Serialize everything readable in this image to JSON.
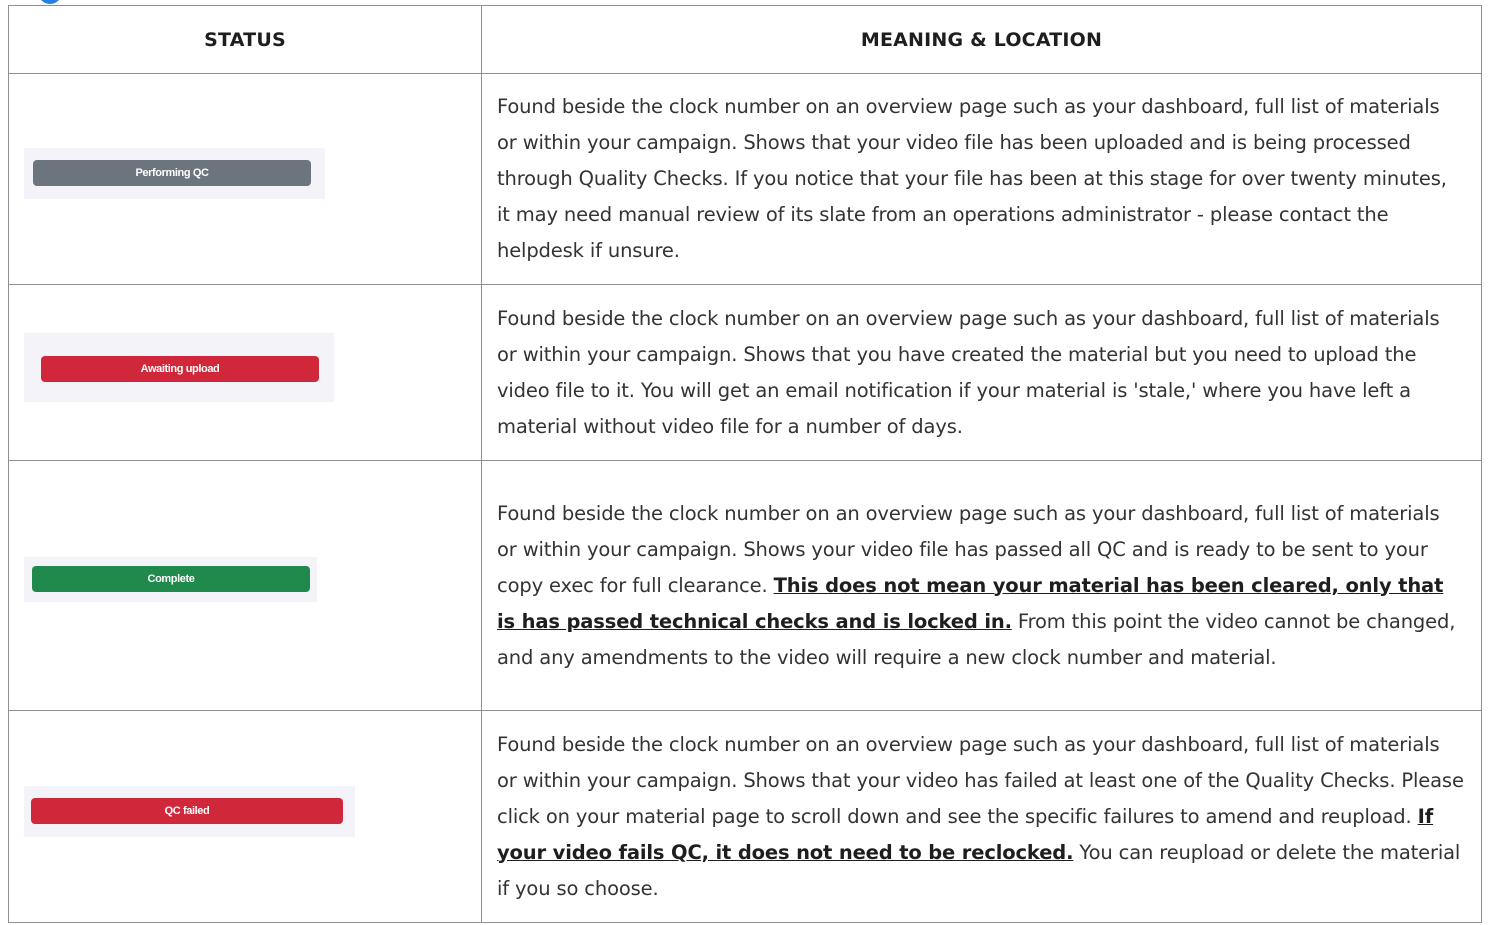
{
  "table": {
    "headers": {
      "status": "STATUS",
      "meaning": "MEANING & LOCATION"
    },
    "rows": [
      {
        "badge_label": "Performing QC",
        "badge_color": "#6c757d",
        "text": "Found beside the clock number on an overview page such as your dashboard, full list of materials or within your campaign. Shows that your video file has been uploaded and is being processed through Quality Checks. If you notice that your file has been at this stage for over twenty minutes, it may need manual review of its slate from an operations administrator - please contact the helpdesk if unsure."
      },
      {
        "badge_label": "Awaiting upload",
        "badge_color": "#d0283a",
        "text": "Found beside the clock number on an overview page such as your dashboard, full list of materials or within your campaign. Shows that you have created the material but you need to upload the video file to it. You will get an email notification if your material is 'stale,' where you have left a material without video file for a number of days."
      },
      {
        "badge_label": "Complete",
        "badge_color": "#1f8a4c",
        "text_before": "Found beside the clock number on an overview page such as your dashboard, full list of materials or within your campaign. Shows your video file has passed all QC and is ready to be sent to your copy exec for full clearance.",
        "text_emphasis": "This does not mean your material has been cleared, only that is has passed technical checks and is locked in.",
        "text_after": "From this point the video cannot be changed, and any amendments to the video will require a new clock number and material."
      },
      {
        "badge_label": "QC failed",
        "badge_color": "#d0283a",
        "text_before": "Found beside the clock number on an overview page such as your dashboard, full list of materials or within your campaign. Shows that your video has failed at least one of the Quality Checks. Please click on your material page to scroll down and see the specific failures to amend and reupload.",
        "text_emphasis": "If your video fails QC, it does not need to be reclocked.",
        "text_after": "You can reupload or delete the material if you so choose."
      }
    ]
  }
}
